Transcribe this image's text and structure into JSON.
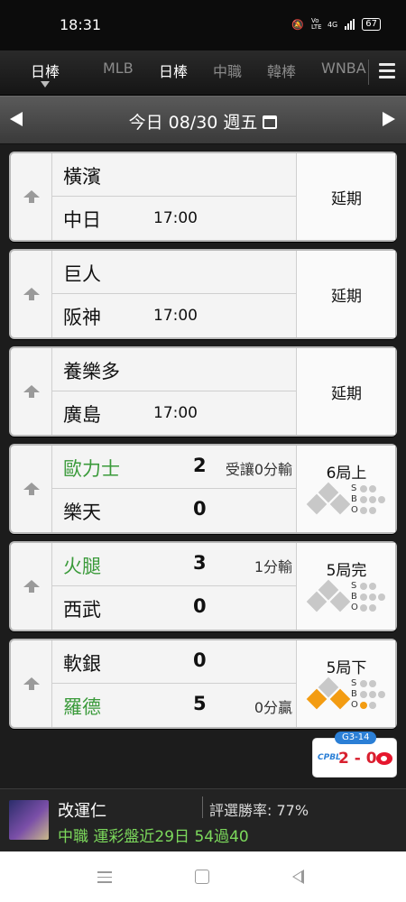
{
  "status_bar": {
    "time": "18:31",
    "network": "4G",
    "volte": "Vo LTE",
    "battery": "67"
  },
  "sport_tabs": {
    "selected": "日棒",
    "items": [
      "MLB",
      "日棒",
      "中職",
      "韓棒",
      "WNBA"
    ]
  },
  "date_bar": {
    "label": "今日 08/30 週五"
  },
  "games": [
    {
      "away": {
        "name": "橫濱",
        "color": "normal"
      },
      "home": {
        "name": "中日",
        "time": "17:00"
      },
      "status": "延期"
    },
    {
      "away": {
        "name": "巨人"
      },
      "home": {
        "name": "阪神",
        "time": "17:00"
      },
      "status": "延期"
    },
    {
      "away": {
        "name": "養樂多"
      },
      "home": {
        "name": "廣島",
        "time": "17:00"
      },
      "status": "延期"
    },
    {
      "away": {
        "name": "歐力士",
        "score": "2",
        "note": "受讓0分輸"
      },
      "home": {
        "name": "樂天",
        "score": "0"
      },
      "status": "6局上",
      "bases": {
        "first": false,
        "second": false,
        "third": false
      },
      "count": {
        "s": 0,
        "b": 0,
        "o": 0
      }
    },
    {
      "away": {
        "name": "火腿",
        "score": "3",
        "note": "1分輸"
      },
      "home": {
        "name": "西武",
        "score": "0"
      },
      "status": "5局完",
      "bases": {
        "first": false,
        "second": false,
        "third": false
      },
      "count": {
        "s": 0,
        "b": 0,
        "o": 0
      }
    },
    {
      "away": {
        "name": "軟銀",
        "score": "0"
      },
      "home": {
        "name": "羅德",
        "score": "5",
        "note": "0分贏"
      },
      "status": "5局下",
      "bases": {
        "first": true,
        "second": false,
        "third": true
      },
      "count": {
        "s": 0,
        "b": 0,
        "o": 1
      }
    }
  ],
  "live_badge": {
    "tag": "G3-14",
    "logo": "CPBL",
    "score": "2 - 0"
  },
  "expert": {
    "name": "改運仁",
    "win_rate": "評選勝率: 77%",
    "record": "中職 運彩盤近29日 54過40"
  },
  "colors": {
    "winner_green": "#3a9a3a",
    "runner_orange": "#f39c12",
    "record_green": "#7cd95c"
  }
}
